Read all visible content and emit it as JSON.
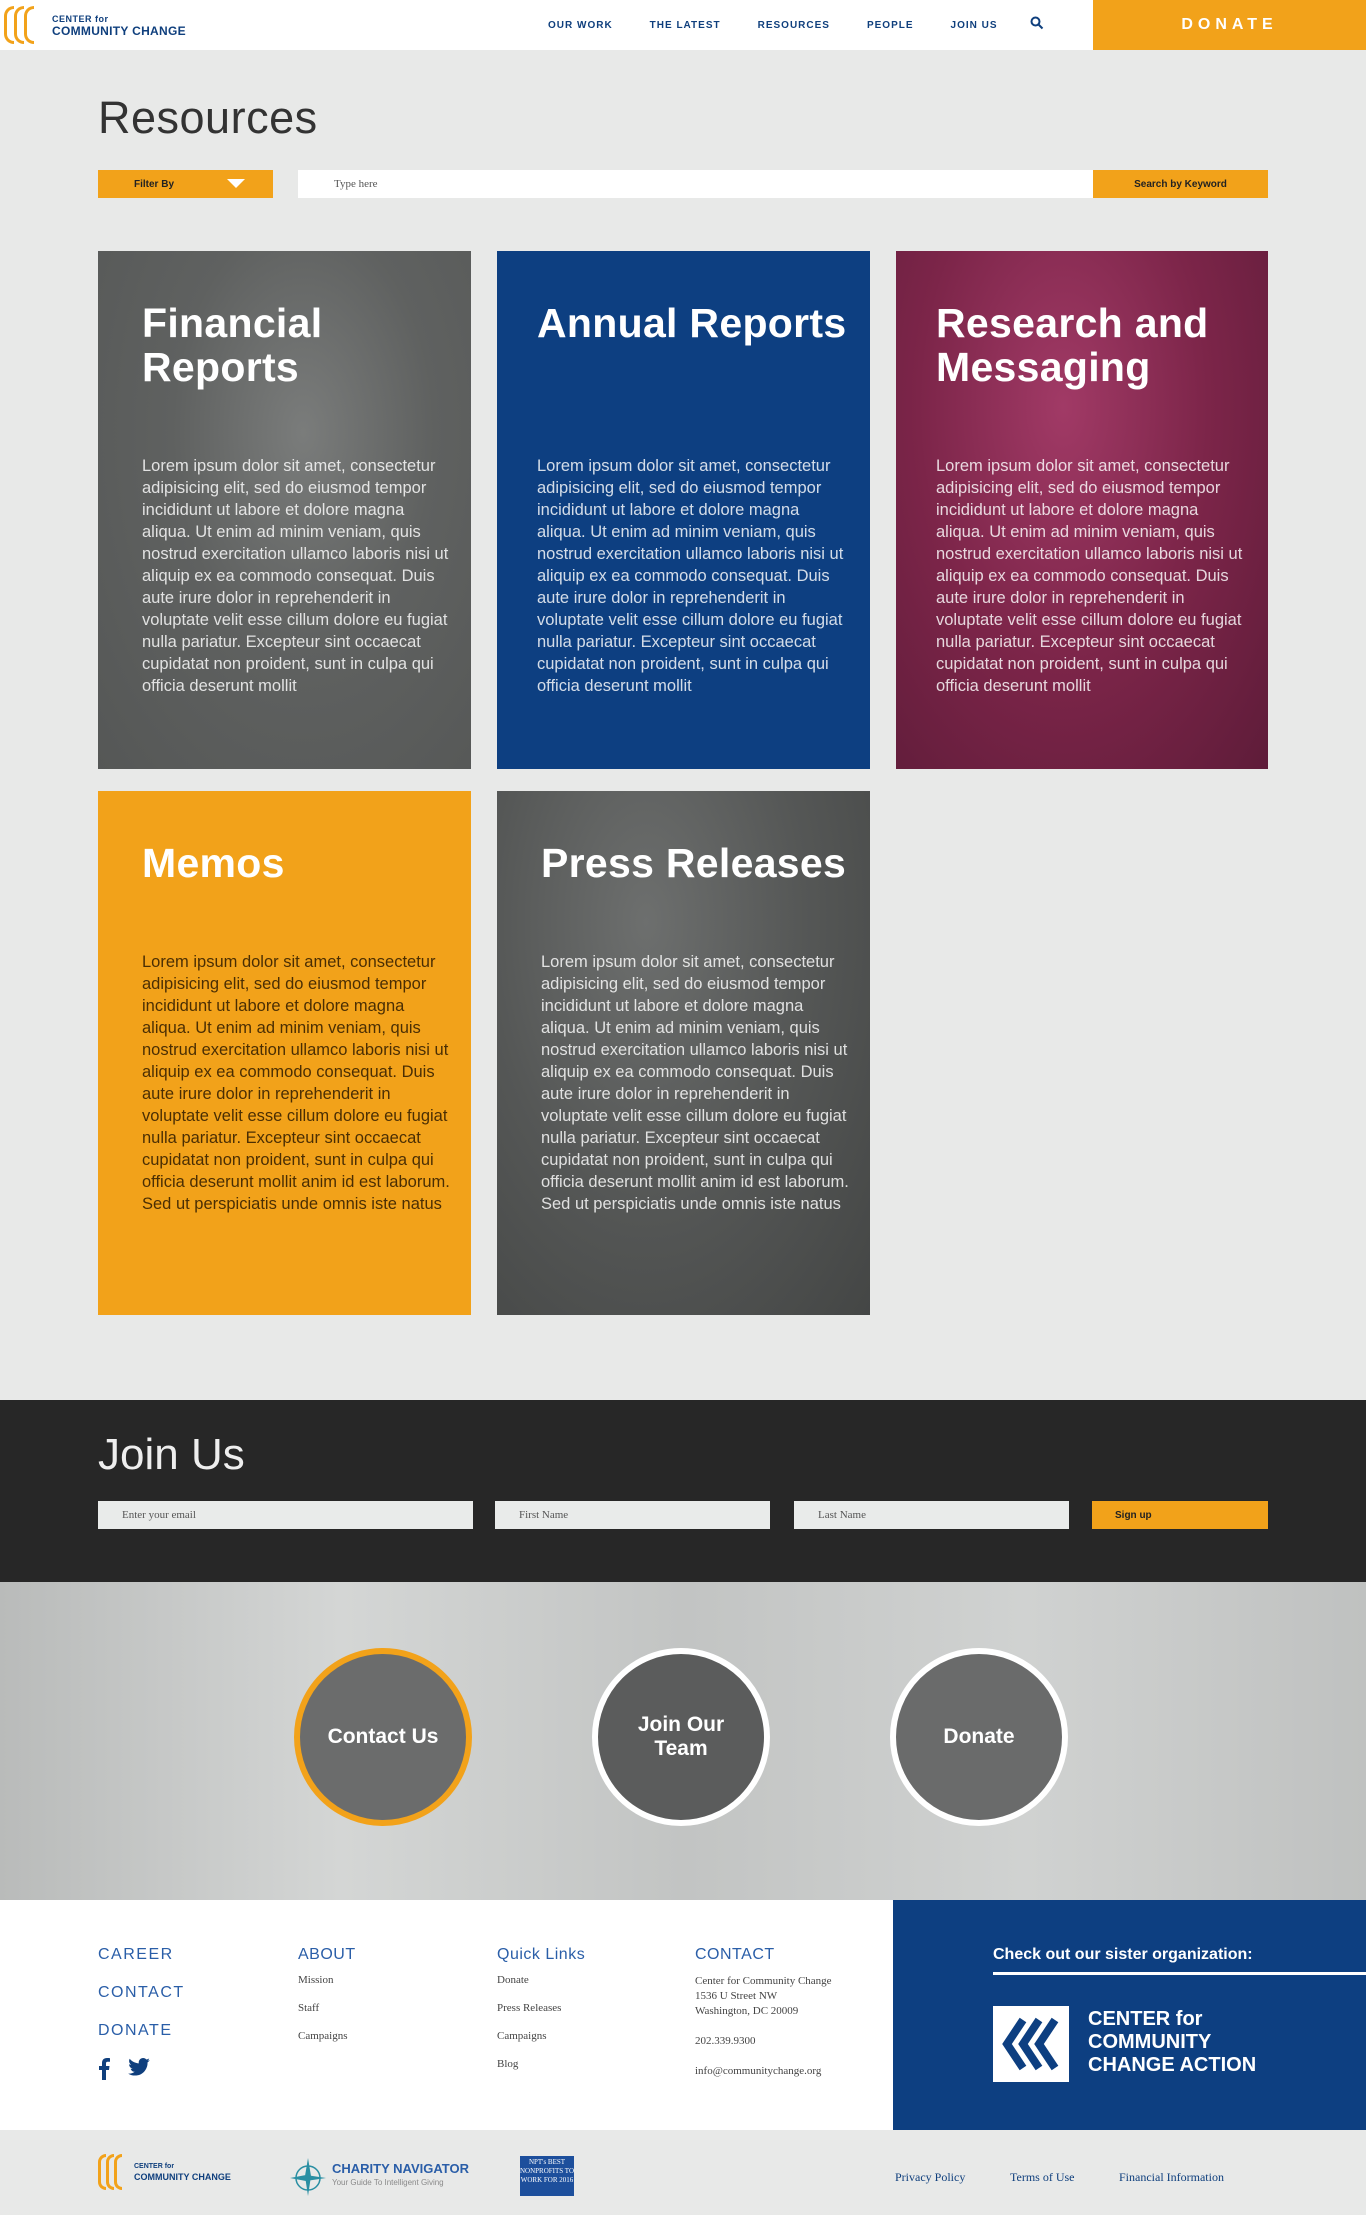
{
  "header": {
    "logo_line1": "CENTER for",
    "logo_line2": "COMMUNITY CHANGE",
    "nav": [
      "OUR WORK",
      "THE LATEST",
      "RESOURCES",
      "PEOPLE",
      "JOIN US"
    ],
    "donate_label": "DONATE"
  },
  "resources": {
    "title": "Resources",
    "filter_label": "Filter By",
    "search_placeholder": "Type here",
    "search_button": "Search by Keyword",
    "cards": [
      {
        "title": "Financial Reports",
        "body": "Lorem ipsum dolor sit amet, consectetur adipisicing elit, sed do eiusmod tempor incididunt ut labore et dolore magna aliqua. Ut enim ad minim veniam, quis nostrud exercitation ullamco laboris nisi ut aliquip ex ea commodo consequat. Duis aute irure dolor in reprehenderit in voluptate velit esse cillum dolore eu fugiat nulla pariatur. Excepteur sint occaecat cupidatat non proident, sunt in culpa qui officia deserunt mollit"
      },
      {
        "title": "Annual Reports",
        "body": "Lorem ipsum dolor sit amet, consectetur adipisicing elit, sed do eiusmod tempor incididunt ut labore et dolore magna aliqua. Ut enim ad minim veniam, quis nostrud exercitation ullamco laboris nisi ut aliquip ex ea commodo consequat. Duis aute irure dolor in reprehenderit in voluptate velit esse cillum dolore eu fugiat nulla pariatur. Excepteur sint occaecat cupidatat non proident, sunt in culpa qui officia deserunt mollit"
      },
      {
        "title": "Research and Messaging",
        "body": "Lorem ipsum dolor sit amet, consectetur adipisicing elit, sed do eiusmod tempor incididunt ut labore et dolore magna aliqua. Ut enim ad minim veniam, quis nostrud exercitation ullamco laboris nisi ut aliquip ex ea commodo consequat. Duis aute irure dolor in reprehenderit in voluptate velit esse cillum dolore eu fugiat nulla pariatur. Excepteur sint occaecat cupidatat non proident, sunt in culpa qui officia deserunt mollit"
      },
      {
        "title": "Memos",
        "body": "Lorem ipsum dolor sit amet, consectetur adipisicing elit, sed do eiusmod tempor incididunt ut labore et dolore magna aliqua. Ut enim ad minim veniam, quis nostrud exercitation ullamco laboris nisi ut aliquip ex ea commodo consequat. Duis aute irure dolor in reprehenderit in voluptate velit esse cillum dolore eu fugiat nulla pariatur. Excepteur sint occaecat cupidatat non proident, sunt in culpa qui officia deserunt mollit anim id est laborum. Sed ut perspiciatis unde omnis iste natus"
      },
      {
        "title": "Press Releases",
        "body": "Lorem ipsum dolor sit amet, consectetur adipisicing elit, sed do eiusmod tempor incididunt ut labore et dolore magna aliqua. Ut enim ad minim veniam, quis nostrud exercitation ullamco laboris nisi ut aliquip ex ea commodo consequat. Duis aute irure dolor in reprehenderit in voluptate velit esse cillum dolore eu fugiat nulla pariatur. Excepteur sint occaecat cupidatat non proident, sunt in culpa qui officia deserunt mollit anim id est laborum. Sed ut perspiciatis unde omnis iste natus"
      }
    ]
  },
  "join": {
    "title": "Join Us",
    "email_placeholder": "Enter your email",
    "first_placeholder": "First Name",
    "last_placeholder": "Last Name",
    "signup_label": "Sign up"
  },
  "band": {
    "contact": "Contact Us",
    "team": "Join Our Team",
    "donate": "Donate"
  },
  "footer": {
    "col1": [
      "CAREER",
      "CONTACT",
      "DONATE"
    ],
    "about": {
      "head": "ABOUT",
      "links": [
        "Mission",
        "Staff",
        "Campaigns"
      ]
    },
    "quick": {
      "head": "Quick Links",
      "links": [
        "Donate",
        "Press Releases",
        "Campaigns",
        "Blog"
      ]
    },
    "contact": {
      "head": "CONTACT",
      "org": "Center for Community Change",
      "street": "1536 U Street NW",
      "city": "Washington, DC 20009",
      "phone": "202.339.9300",
      "email": "info@communitychange.org"
    },
    "sister": {
      "title": "Check out our sister organization:",
      "l1": "CENTER for",
      "l2": "COMMUNITY",
      "l3": "CHANGE ACTION"
    }
  },
  "bottom": {
    "logo_line1": "CENTER for",
    "logo_line2": "COMMUNITY CHANGE",
    "charity_title": "CHARITY NAVIGATOR",
    "charity_sub": "Your Guide To Intelligent Giving",
    "npt": "NPT's BEST NONPROFITS TO WORK FOR 2016",
    "links": [
      "Privacy Policy",
      "Terms of Use",
      "Financial Information"
    ]
  },
  "colors": {
    "accent": "#f2a21a",
    "navy": "#0f3f7d",
    "dark": "#272727"
  }
}
